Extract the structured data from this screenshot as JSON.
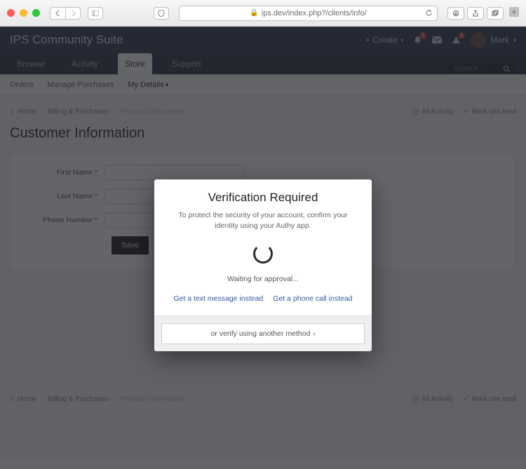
{
  "browser": {
    "url_display": "ips.dev/index.php?/clients/info/",
    "secure": true
  },
  "header": {
    "brand": "IPS Community Suite",
    "create_label": "Create",
    "username": "Mark",
    "notif_bell_count": "1",
    "notif_warn_count": "1"
  },
  "tabs": {
    "items": [
      "Browse",
      "Activity",
      "Store",
      "Support"
    ],
    "active_index": 2,
    "search_placeholder": "Search..."
  },
  "subnav": {
    "items": [
      "Orders",
      "Manage Purchases",
      "My Details"
    ],
    "active_index": 2
  },
  "breadcrumb": {
    "home": "Home",
    "section": "Billing & Purchases",
    "current": "Personal Information",
    "all_activity": "All Activity",
    "mark_read": "Mark site read"
  },
  "page": {
    "title": "Customer Information",
    "fields": {
      "first_name": {
        "label": "First Name",
        "value": ""
      },
      "last_name": {
        "label": "Last Name",
        "value": ""
      },
      "phone": {
        "label": "Phone Number",
        "value": ""
      }
    },
    "save_label": "Save"
  },
  "modal": {
    "title": "Verification Required",
    "description": "To protect the security of your account, confirm your identity using your Authy app.",
    "waiting": "Waiting for approval...",
    "link_text": "Get a text message instead",
    "link_call": "Get a phone call instead",
    "alt_method": "or verify using another method"
  }
}
